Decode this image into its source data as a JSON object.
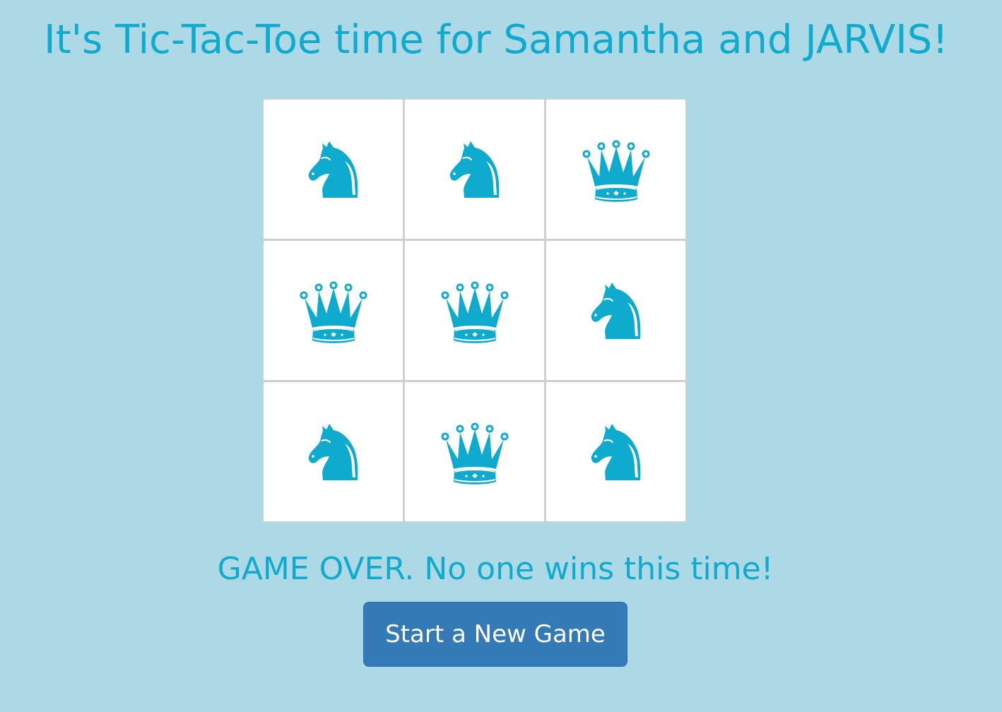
{
  "title": "It's Tic-Tac-Toe time for Samantha and JARVIS!",
  "board": {
    "cells": [
      {
        "piece": "knight-icon"
      },
      {
        "piece": "knight-icon"
      },
      {
        "piece": "queen-icon"
      },
      {
        "piece": "queen-icon"
      },
      {
        "piece": "queen-icon"
      },
      {
        "piece": "knight-icon"
      },
      {
        "piece": "knight-icon"
      },
      {
        "piece": "queen-icon"
      },
      {
        "piece": "knight-icon"
      }
    ]
  },
  "status": "GAME OVER. No one wins this time!",
  "new_game_label": "Start a New Game",
  "colors": {
    "background": "#add8e6",
    "accent": "#0eabcf",
    "cell": "#ffffff",
    "grid": "#cfcfcf",
    "button": "#337ab7"
  }
}
